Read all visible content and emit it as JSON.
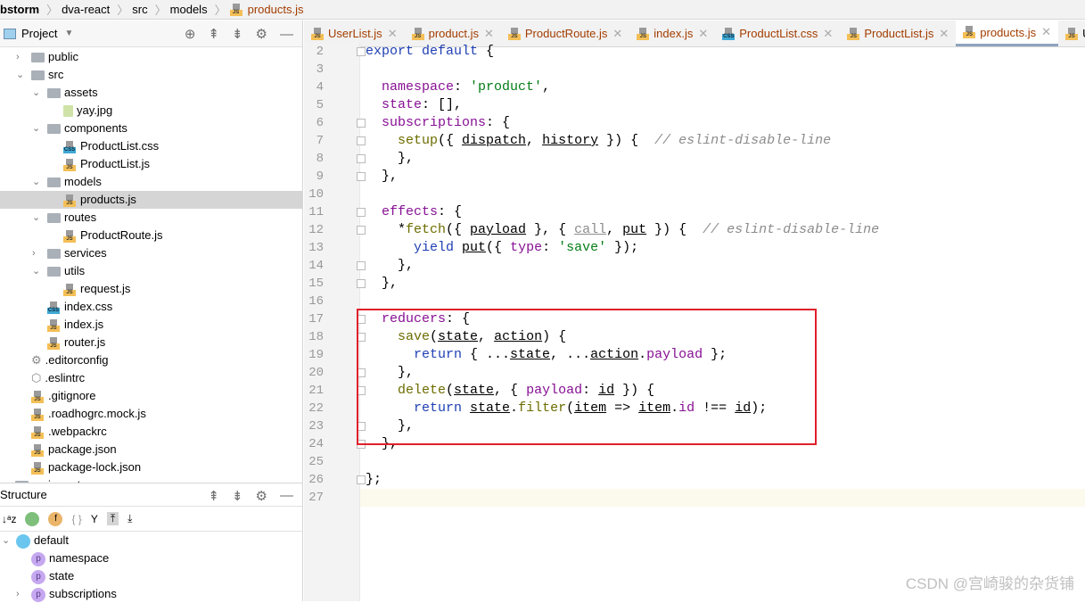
{
  "breadcrumb": [
    "bstorm",
    "dva-react",
    "src",
    "models",
    "products.js"
  ],
  "project_panel": {
    "title": "Project",
    "tree": [
      {
        "label": "public",
        "type": "folder",
        "level": 1,
        "chevron": "right"
      },
      {
        "label": "src",
        "type": "folder",
        "level": 1,
        "chevron": "down"
      },
      {
        "label": "assets",
        "type": "folder",
        "level": 2,
        "chevron": "down"
      },
      {
        "label": "yay.jpg",
        "type": "image",
        "level": 3
      },
      {
        "label": "components",
        "type": "folder",
        "level": 2,
        "chevron": "down"
      },
      {
        "label": "ProductList.css",
        "type": "css",
        "level": 3
      },
      {
        "label": "ProductList.js",
        "type": "js",
        "level": 3
      },
      {
        "label": "models",
        "type": "folder",
        "level": 2,
        "chevron": "down"
      },
      {
        "label": "products.js",
        "type": "js",
        "level": 3,
        "selected": true
      },
      {
        "label": "routes",
        "type": "folder",
        "level": 2,
        "chevron": "down"
      },
      {
        "label": "ProductRoute.js",
        "type": "js",
        "level": 3
      },
      {
        "label": "services",
        "type": "folder",
        "level": 2,
        "chevron": "right"
      },
      {
        "label": "utils",
        "type": "folder",
        "level": 2,
        "chevron": "down"
      },
      {
        "label": "request.js",
        "type": "js",
        "level": 3
      },
      {
        "label": "index.css",
        "type": "css",
        "level": 2
      },
      {
        "label": "index.js",
        "type": "js",
        "level": 2
      },
      {
        "label": "router.js",
        "type": "js",
        "level": 2
      },
      {
        "label": ".editorconfig",
        "type": "config",
        "level": 1
      },
      {
        "label": ".eslintrc",
        "type": "eslint",
        "level": 1
      },
      {
        "label": ".gitignore",
        "type": "js",
        "level": 1
      },
      {
        "label": ".roadhogrc.mock.js",
        "type": "js",
        "level": 1
      },
      {
        "label": ".webpackrc",
        "type": "js",
        "level": 1
      },
      {
        "label": "package.json",
        "type": "js",
        "level": 1
      },
      {
        "label": "package-lock.json",
        "type": "js",
        "level": 1
      },
      {
        "label": "umi-react",
        "type": "folder",
        "level": 0,
        "chevron": "right"
      }
    ]
  },
  "structure_panel": {
    "title": "Structure",
    "root": "default",
    "items": [
      "namespace",
      "state",
      "subscriptions"
    ]
  },
  "tabs": [
    {
      "label": "UserList.js",
      "type": "js"
    },
    {
      "label": "product.js",
      "type": "js"
    },
    {
      "label": "ProductRoute.js",
      "type": "js"
    },
    {
      "label": "index.js",
      "type": "js"
    },
    {
      "label": "ProductList.css",
      "type": "css"
    },
    {
      "label": "ProductList.js",
      "type": "js"
    },
    {
      "label": "products.js",
      "type": "js",
      "active": true
    },
    {
      "label": "UserList.js",
      "type": "js"
    }
  ],
  "code": [
    {
      "n": "2",
      "t": [
        [
          "export default ",
          "kw"
        ],
        [
          "{",
          "pl"
        ]
      ]
    },
    {
      "n": "3",
      "t": []
    },
    {
      "n": "4",
      "t": [
        [
          "  namespace",
          "pr"
        ],
        [
          ": ",
          "pl"
        ],
        [
          "'product'",
          "st"
        ],
        [
          ",",
          "pl"
        ]
      ]
    },
    {
      "n": "5",
      "t": [
        [
          "  state",
          "pr"
        ],
        [
          ": [],",
          "pl"
        ]
      ]
    },
    {
      "n": "6",
      "t": [
        [
          "  subscriptions",
          "pr"
        ],
        [
          ": {",
          "pl"
        ]
      ]
    },
    {
      "n": "7",
      "t": [
        [
          "    setup",
          "fn"
        ],
        [
          "({ ",
          "pl"
        ],
        [
          "dispatch",
          "u"
        ],
        [
          ", ",
          "pl"
        ],
        [
          "history",
          "u"
        ],
        [
          " }) {  ",
          "pl"
        ],
        [
          "// eslint-disable-line",
          "cm"
        ]
      ]
    },
    {
      "n": "8",
      "t": [
        [
          "    },",
          "pl"
        ]
      ]
    },
    {
      "n": "9",
      "t": [
        [
          "  },",
          "pl"
        ]
      ]
    },
    {
      "n": "10",
      "t": []
    },
    {
      "n": "11",
      "t": [
        [
          "  effects",
          "pr"
        ],
        [
          ": {",
          "pl"
        ]
      ]
    },
    {
      "n": "12",
      "t": [
        [
          "    *",
          "pl"
        ],
        [
          "fetch",
          "fn"
        ],
        [
          "({ ",
          "pl"
        ],
        [
          "payload",
          "u"
        ],
        [
          " }, { ",
          "pl"
        ],
        [
          "call",
          "gr"
        ],
        [
          ", ",
          "pl"
        ],
        [
          "put",
          "u"
        ],
        [
          " }) {  ",
          "pl"
        ],
        [
          "// eslint-disable-line",
          "cm"
        ]
      ]
    },
    {
      "n": "13",
      "t": [
        [
          "      yield ",
          "kw"
        ],
        [
          "put",
          "u"
        ],
        [
          "({ ",
          "pl"
        ],
        [
          "type",
          "pr"
        ],
        [
          ": ",
          "pl"
        ],
        [
          "'save'",
          "st"
        ],
        [
          " });",
          "pl"
        ]
      ]
    },
    {
      "n": "14",
      "t": [
        [
          "    },",
          "pl"
        ]
      ]
    },
    {
      "n": "15",
      "t": [
        [
          "  },",
          "pl"
        ]
      ]
    },
    {
      "n": "16",
      "t": []
    },
    {
      "n": "17",
      "t": [
        [
          "  reducers",
          "pr"
        ],
        [
          ": {",
          "pl"
        ]
      ]
    },
    {
      "n": "18",
      "t": [
        [
          "    save",
          "fn"
        ],
        [
          "(",
          "pl"
        ],
        [
          "state",
          "u"
        ],
        [
          ", ",
          "pl"
        ],
        [
          "action",
          "u"
        ],
        [
          ") {",
          "pl"
        ]
      ]
    },
    {
      "n": "19",
      "t": [
        [
          "      return ",
          "kw"
        ],
        [
          "{ ...",
          "pl"
        ],
        [
          "state",
          "u"
        ],
        [
          ", ...",
          "pl"
        ],
        [
          "action",
          "u"
        ],
        [
          ".",
          "pl"
        ],
        [
          "payload",
          "pr"
        ],
        [
          " };",
          "pl"
        ]
      ]
    },
    {
      "n": "20",
      "t": [
        [
          "    },",
          "pl"
        ]
      ]
    },
    {
      "n": "21",
      "t": [
        [
          "    delete",
          "fn"
        ],
        [
          "(",
          "pl"
        ],
        [
          "state",
          "u"
        ],
        [
          ", { ",
          "pl"
        ],
        [
          "payload",
          "pr"
        ],
        [
          ": ",
          "pl"
        ],
        [
          "id",
          "u"
        ],
        [
          " }) {",
          "pl"
        ]
      ]
    },
    {
      "n": "22",
      "t": [
        [
          "      return ",
          "kw"
        ],
        [
          "state",
          "u"
        ],
        [
          ".",
          "pl"
        ],
        [
          "filter",
          "fn"
        ],
        [
          "(",
          "pl"
        ],
        [
          "item",
          "u"
        ],
        [
          " => ",
          "pl"
        ],
        [
          "item",
          "u"
        ],
        [
          ".",
          "pl"
        ],
        [
          "id",
          "pr"
        ],
        [
          " !== ",
          "pl"
        ],
        [
          "id",
          "u"
        ],
        [
          ");",
          "pl"
        ]
      ]
    },
    {
      "n": "23",
      "t": [
        [
          "    },",
          "pl"
        ]
      ]
    },
    {
      "n": "24",
      "t": [
        [
          "  },",
          "pl"
        ]
      ]
    },
    {
      "n": "25",
      "t": []
    },
    {
      "n": "26",
      "t": [
        [
          "};",
          "pl"
        ]
      ]
    },
    {
      "n": "27",
      "t": []
    }
  ],
  "fold_lines": [
    "2",
    "6",
    "7",
    "8",
    "9",
    "11",
    "12",
    "14",
    "15",
    "17",
    "18",
    "20",
    "21",
    "23",
    "24",
    "26"
  ],
  "highlight_color": "#e0202a",
  "watermark": "CSDN @宫崎骏的杂货铺"
}
